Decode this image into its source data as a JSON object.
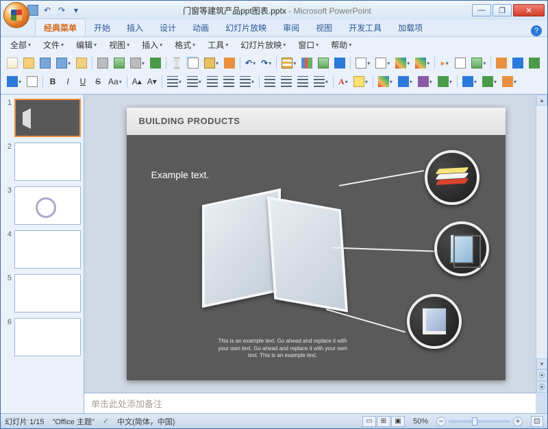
{
  "titlebar": {
    "filename": "门窗等建筑产品ppt图表.pptx",
    "app": "Microsoft PowerPoint"
  },
  "tabs": [
    "经典菜单",
    "开始",
    "插入",
    "设计",
    "动画",
    "幻灯片放映",
    "审阅",
    "视图",
    "开发工具",
    "加载项"
  ],
  "menus": [
    "全部",
    "文件",
    "编辑",
    "视图",
    "插入",
    "格式",
    "工具",
    "幻灯片放映",
    "窗口",
    "帮助"
  ],
  "slide": {
    "title": "BUILDING PRODUCTS",
    "example_text": "Example text.",
    "footer_text": "This is an example text. Go ahead and replace it with your own text. Go ahead and replace it with your own text. This is an example text."
  },
  "thumbnails": [
    "1",
    "2",
    "3",
    "4",
    "5",
    "6"
  ],
  "notes_placeholder": "单击此处添加备注",
  "status": {
    "slide_counter": "幻灯片 1/15",
    "theme": "\"Office 主题\"",
    "language": "中文(简体，中国)",
    "zoom": "50%"
  }
}
